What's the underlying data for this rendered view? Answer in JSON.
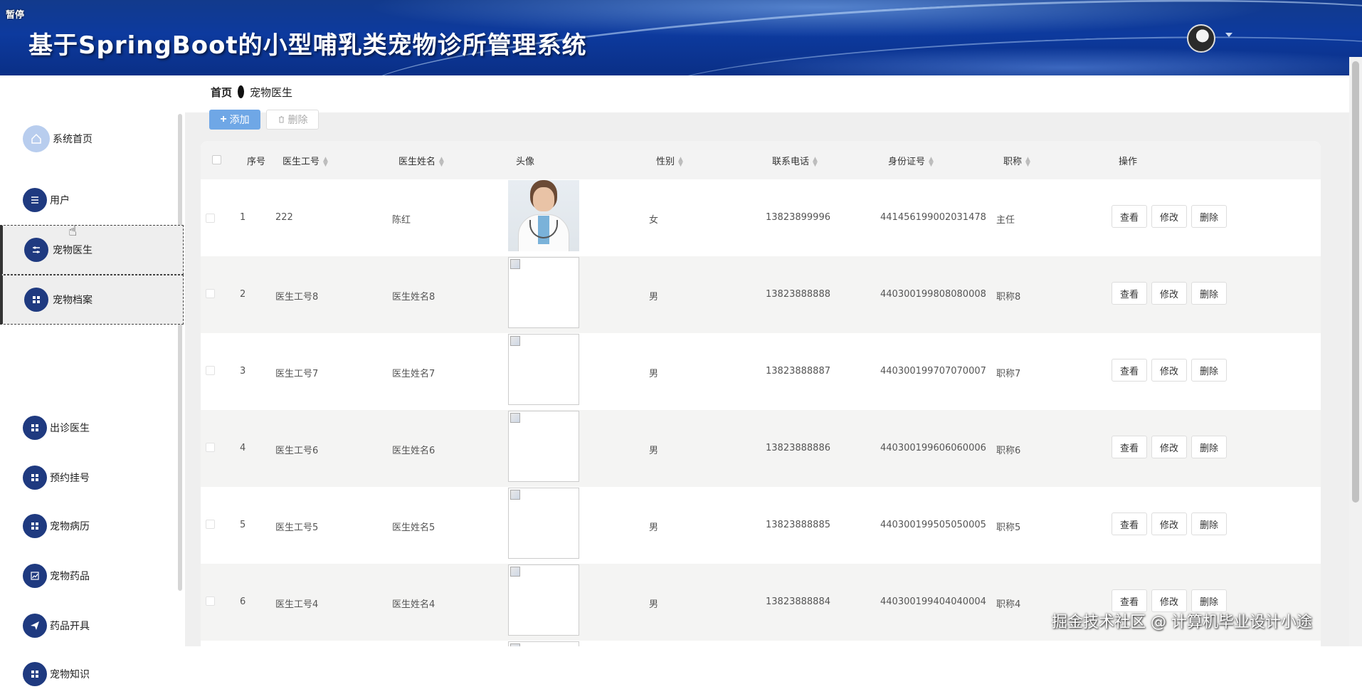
{
  "header": {
    "pause_badge": "暂停",
    "title": "基于SpringBoot的小型哺乳类宠物诊所管理系统"
  },
  "sidebar": {
    "items": [
      {
        "label": "系统首页",
        "icon": "home-icon"
      },
      {
        "label": "用户",
        "icon": "list-icon"
      },
      {
        "label": "宠物医生",
        "icon": "sliders-icon"
      },
      {
        "label": "宠物档案",
        "icon": "grid-icon"
      },
      {
        "label": "出诊医生",
        "icon": "grid-icon"
      },
      {
        "label": "预约挂号",
        "icon": "grid-icon"
      },
      {
        "label": "宠物病历",
        "icon": "grid-icon"
      },
      {
        "label": "宠物药品",
        "icon": "chart-icon"
      },
      {
        "label": "药品开具",
        "icon": "send-icon"
      },
      {
        "label": "宠物知识",
        "icon": "grid-icon"
      }
    ],
    "active_index": 2
  },
  "breadcrumb": {
    "home": "首页",
    "current": "宠物医生"
  },
  "toolbar": {
    "add_label": "添加",
    "delete_label": "删除"
  },
  "table": {
    "headers": {
      "index": "序号",
      "doctor_id": "医生工号",
      "doctor_name": "医生姓名",
      "avatar": "头像",
      "gender": "性别",
      "phone": "联系电话",
      "id_card": "身份证号",
      "title": "职称",
      "actions": "操作"
    },
    "rows": [
      {
        "index": "1",
        "doctor_id": "222",
        "doctor_name": "陈红",
        "gender": "女",
        "phone": "13823899996",
        "id_card": "441456199002031478",
        "title": "主任",
        "has_photo": true
      },
      {
        "index": "2",
        "doctor_id": "医生工号8",
        "doctor_name": "医生姓名8",
        "gender": "男",
        "phone": "13823888888",
        "id_card": "440300199808080008",
        "title": "职称8",
        "has_photo": false
      },
      {
        "index": "3",
        "doctor_id": "医生工号7",
        "doctor_name": "医生姓名7",
        "gender": "男",
        "phone": "13823888887",
        "id_card": "440300199707070007",
        "title": "职称7",
        "has_photo": false
      },
      {
        "index": "4",
        "doctor_id": "医生工号6",
        "doctor_name": "医生姓名6",
        "gender": "男",
        "phone": "13823888886",
        "id_card": "440300199606060006",
        "title": "职称6",
        "has_photo": false
      },
      {
        "index": "5",
        "doctor_id": "医生工号5",
        "doctor_name": "医生姓名5",
        "gender": "男",
        "phone": "13823888885",
        "id_card": "440300199505050005",
        "title": "职称5",
        "has_photo": false
      },
      {
        "index": "6",
        "doctor_id": "医生工号4",
        "doctor_name": "医生姓名4",
        "gender": "男",
        "phone": "13823888884",
        "id_card": "440300199404040004",
        "title": "职称4",
        "has_photo": false
      }
    ],
    "row_actions": {
      "view": "查看",
      "edit": "修改",
      "delete": "删除"
    }
  },
  "watermark": "掘金技术社区 @ 计算机毕业设计小途",
  "colors": {
    "header_blue": "#0d3a9e",
    "menu_icon_bg": "#1f3a80",
    "add_button": "#6fa7e6"
  }
}
